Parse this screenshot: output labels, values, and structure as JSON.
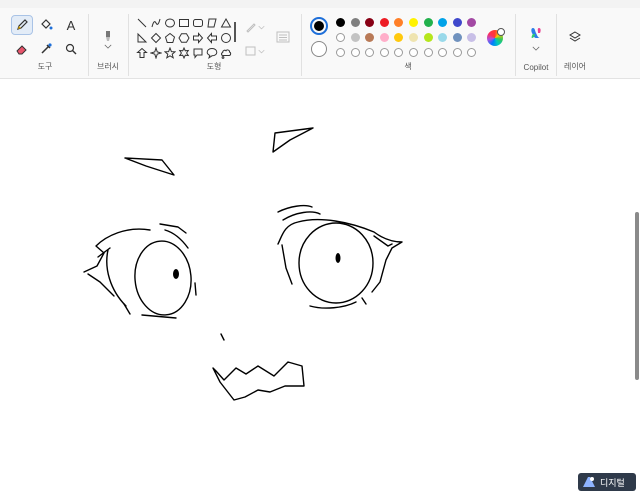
{
  "ribbon": {
    "groups": {
      "tools": "도구",
      "brushes": "브러시",
      "shapes": "도형",
      "colors": "색",
      "copilot": "Copilot",
      "layers": "레이어"
    },
    "tools": [
      "pencil-icon",
      "fill-bucket-icon",
      "text-icon",
      "eraser-icon",
      "color-picker-icon",
      "magnifier-icon"
    ],
    "text_tool_glyph": "A"
  },
  "colors": {
    "primary": "#000000",
    "secondary": "#ffffff",
    "palette_row1": [
      "#000000",
      "#7f7f7f",
      "#880015",
      "#ed1c24",
      "#ff7f27",
      "#fff200",
      "#22b14c",
      "#00a2e8",
      "#3f48cc",
      "#a349a4"
    ],
    "palette_row2": [
      "#ffffff",
      "#c3c3c3",
      "#b97a57",
      "#ffaec9",
      "#ffc90e",
      "#efe4b0",
      "#b5e61d",
      "#99d9ea",
      "#7092be",
      "#c8bfe7"
    ],
    "palette_row3": [
      "",
      "",
      "",
      "",
      "",
      "",
      "",
      "",
      "",
      ""
    ]
  },
  "watermark": {
    "text": "디지털"
  }
}
